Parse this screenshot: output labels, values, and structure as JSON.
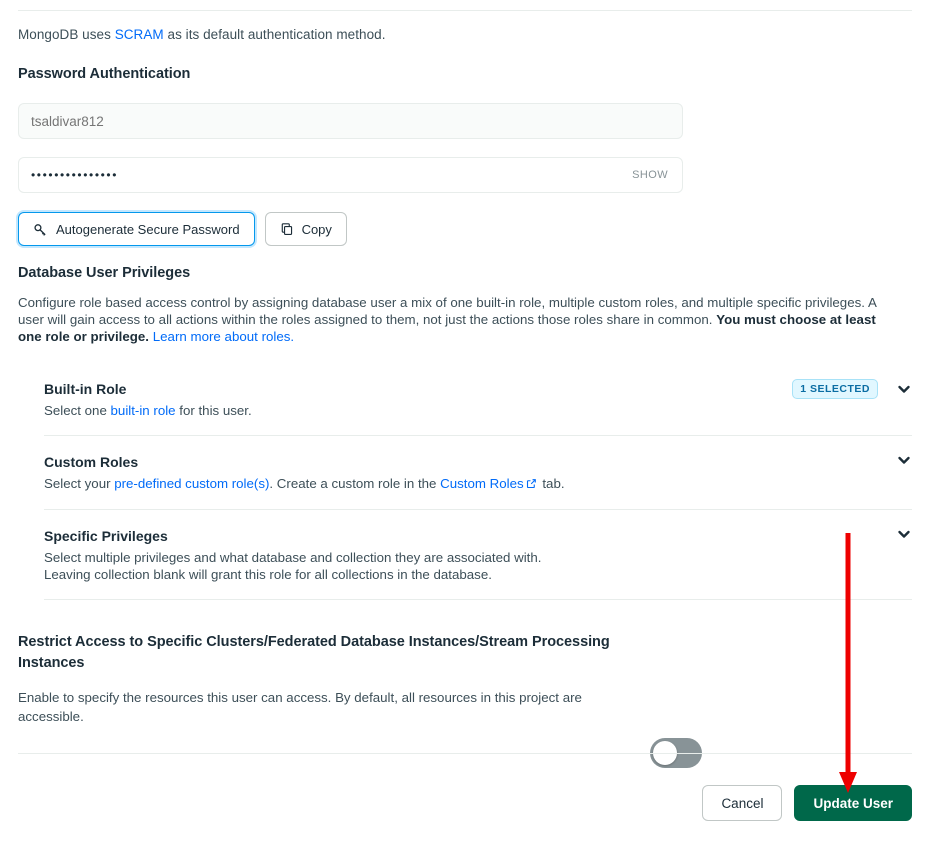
{
  "intro": {
    "before": "MongoDB uses ",
    "link": "SCRAM",
    "after": " as its default authentication method."
  },
  "password_section": {
    "heading": "Password Authentication",
    "username_value": "tsaldivar812",
    "username_placeholder": "tsaldivar812",
    "password_masked": "•••••••••••••••",
    "show_label": "SHOW",
    "autogenerate_label": "Autogenerate Secure Password",
    "copy_label": "Copy",
    "key_icon": "key-icon",
    "copy_icon": "copy-icon"
  },
  "privileges": {
    "heading": "Database User Privileges",
    "description_part1": "Configure role based access control by assigning database user a mix of one built-in role, multiple custom roles, and multiple specific privileges. A user will gain access to all actions within the roles assigned to them, not just the actions those roles share in common. ",
    "description_bold": "You must choose at least one role or privilege.",
    "description_link": "Learn more about roles.",
    "rows": [
      {
        "title": "Built-in Role",
        "sub_before": "Select one ",
        "sub_link": "built-in role",
        "sub_after": " for this user.",
        "badge": "1 SELECTED"
      },
      {
        "title": "Custom Roles",
        "sub_before": "Select your ",
        "sub_link": "pre-defined custom role(s)",
        "sub_mid": ". Create a custom role in the ",
        "sub_link2": "Custom Roles",
        "sub_after": " tab.",
        "badge": ""
      },
      {
        "title": "Specific Privileges",
        "sub_line1": "Select multiple privileges and what database and collection they are associated with.",
        "sub_line2": "Leaving collection blank will grant this role for all collections in the database.",
        "badge": ""
      }
    ]
  },
  "restrict": {
    "heading": "Restrict Access to Specific Clusters/Federated Database Instances/Stream Processing Instances",
    "description": "Enable to specify the resources this user can access. By default, all resources in this project are accessible.",
    "toggle_state": "off"
  },
  "footer": {
    "cancel_label": "Cancel",
    "submit_label": "Update User"
  },
  "colors": {
    "accent_link": "#016bf8",
    "primary_green": "#00684a",
    "badge_bg": "#e1f7ff",
    "badge_text": "#0b6da3",
    "annotation_red": "#ee0000"
  },
  "annotation": {
    "type": "arrow",
    "points_to": "Update User"
  }
}
